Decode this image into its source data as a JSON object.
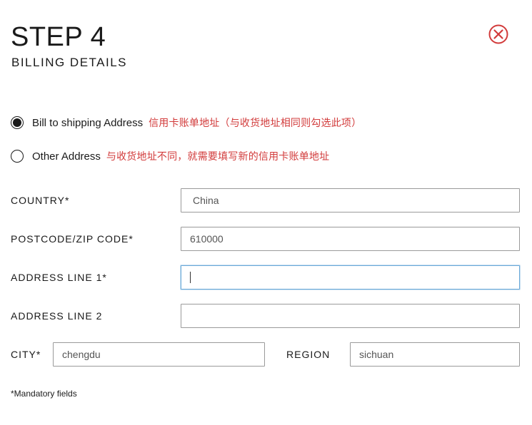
{
  "header": {
    "title": "STEP 4",
    "subtitle": "BILLING DETAILS"
  },
  "billing_options": [
    {
      "label": "Bill to shipping Address",
      "note": "信用卡账单地址（与收货地址相同则勾选此项）",
      "selected": true
    },
    {
      "label": "Other Address",
      "note": "与收货地址不同，就需要填写新的信用卡账单地址",
      "selected": false
    }
  ],
  "form": {
    "country": {
      "label": "COUNTRY*",
      "value": "China"
    },
    "postcode": {
      "label": "POSTCODE/ZIP CODE*",
      "value": "610000"
    },
    "address1": {
      "label": "ADDRESS LINE 1*",
      "value": ""
    },
    "address2": {
      "label": "ADDRESS LINE 2",
      "value": ""
    },
    "city": {
      "label": "CITY*",
      "value": "chengdu"
    },
    "region": {
      "label": "REGION",
      "value": "sichuan"
    }
  },
  "footer": {
    "mandatory_note": "*Mandatory fields"
  },
  "colors": {
    "accent_red": "#d23b3b",
    "focus_blue": "#6aa9d8"
  },
  "icons": {
    "close": "close-circle-x-icon"
  }
}
